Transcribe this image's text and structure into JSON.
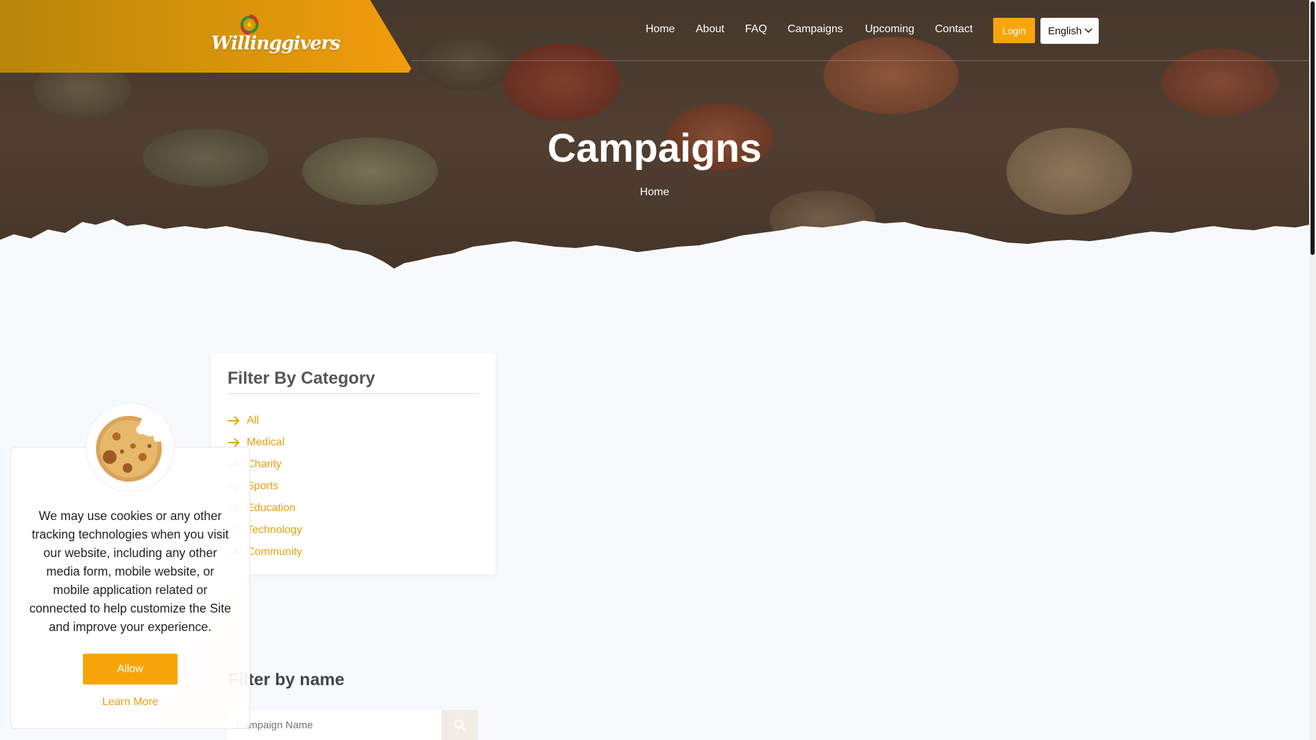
{
  "brand": {
    "logo_text": "Willinggivers",
    "accent": "#f7a50a",
    "link_color": "#e6a010"
  },
  "nav": {
    "items": [
      {
        "label": "Home"
      },
      {
        "label": "About"
      },
      {
        "label": "FAQ"
      },
      {
        "label": "Campaigns"
      },
      {
        "label": "Upcoming"
      },
      {
        "label": "Contact"
      }
    ],
    "login_label": "Login",
    "language": "English"
  },
  "hero": {
    "title": "Campaigns",
    "breadcrumb": "Home"
  },
  "category_filter": {
    "title": "Filter By Category",
    "items": [
      {
        "label": "All"
      },
      {
        "label": "Medical"
      },
      {
        "label": "Charity"
      },
      {
        "label": "Sports"
      },
      {
        "label": "Education"
      },
      {
        "label": "Technology"
      },
      {
        "label": "Community"
      }
    ],
    "arrow_icon": "arrow-right-icon"
  },
  "name_filter": {
    "title": "Filter by name",
    "placeholder": "Campaign Name",
    "search_icon": "search-icon"
  },
  "cookie": {
    "text": "We may use cookies or any other tracking technologies when you visit our website, including any other media form, mobile website, or mobile application related or connected to help customize the Site and improve your experience.",
    "allow_label": "Allow",
    "learn_more_label": "Learn More",
    "icon": "cookie-icon"
  }
}
